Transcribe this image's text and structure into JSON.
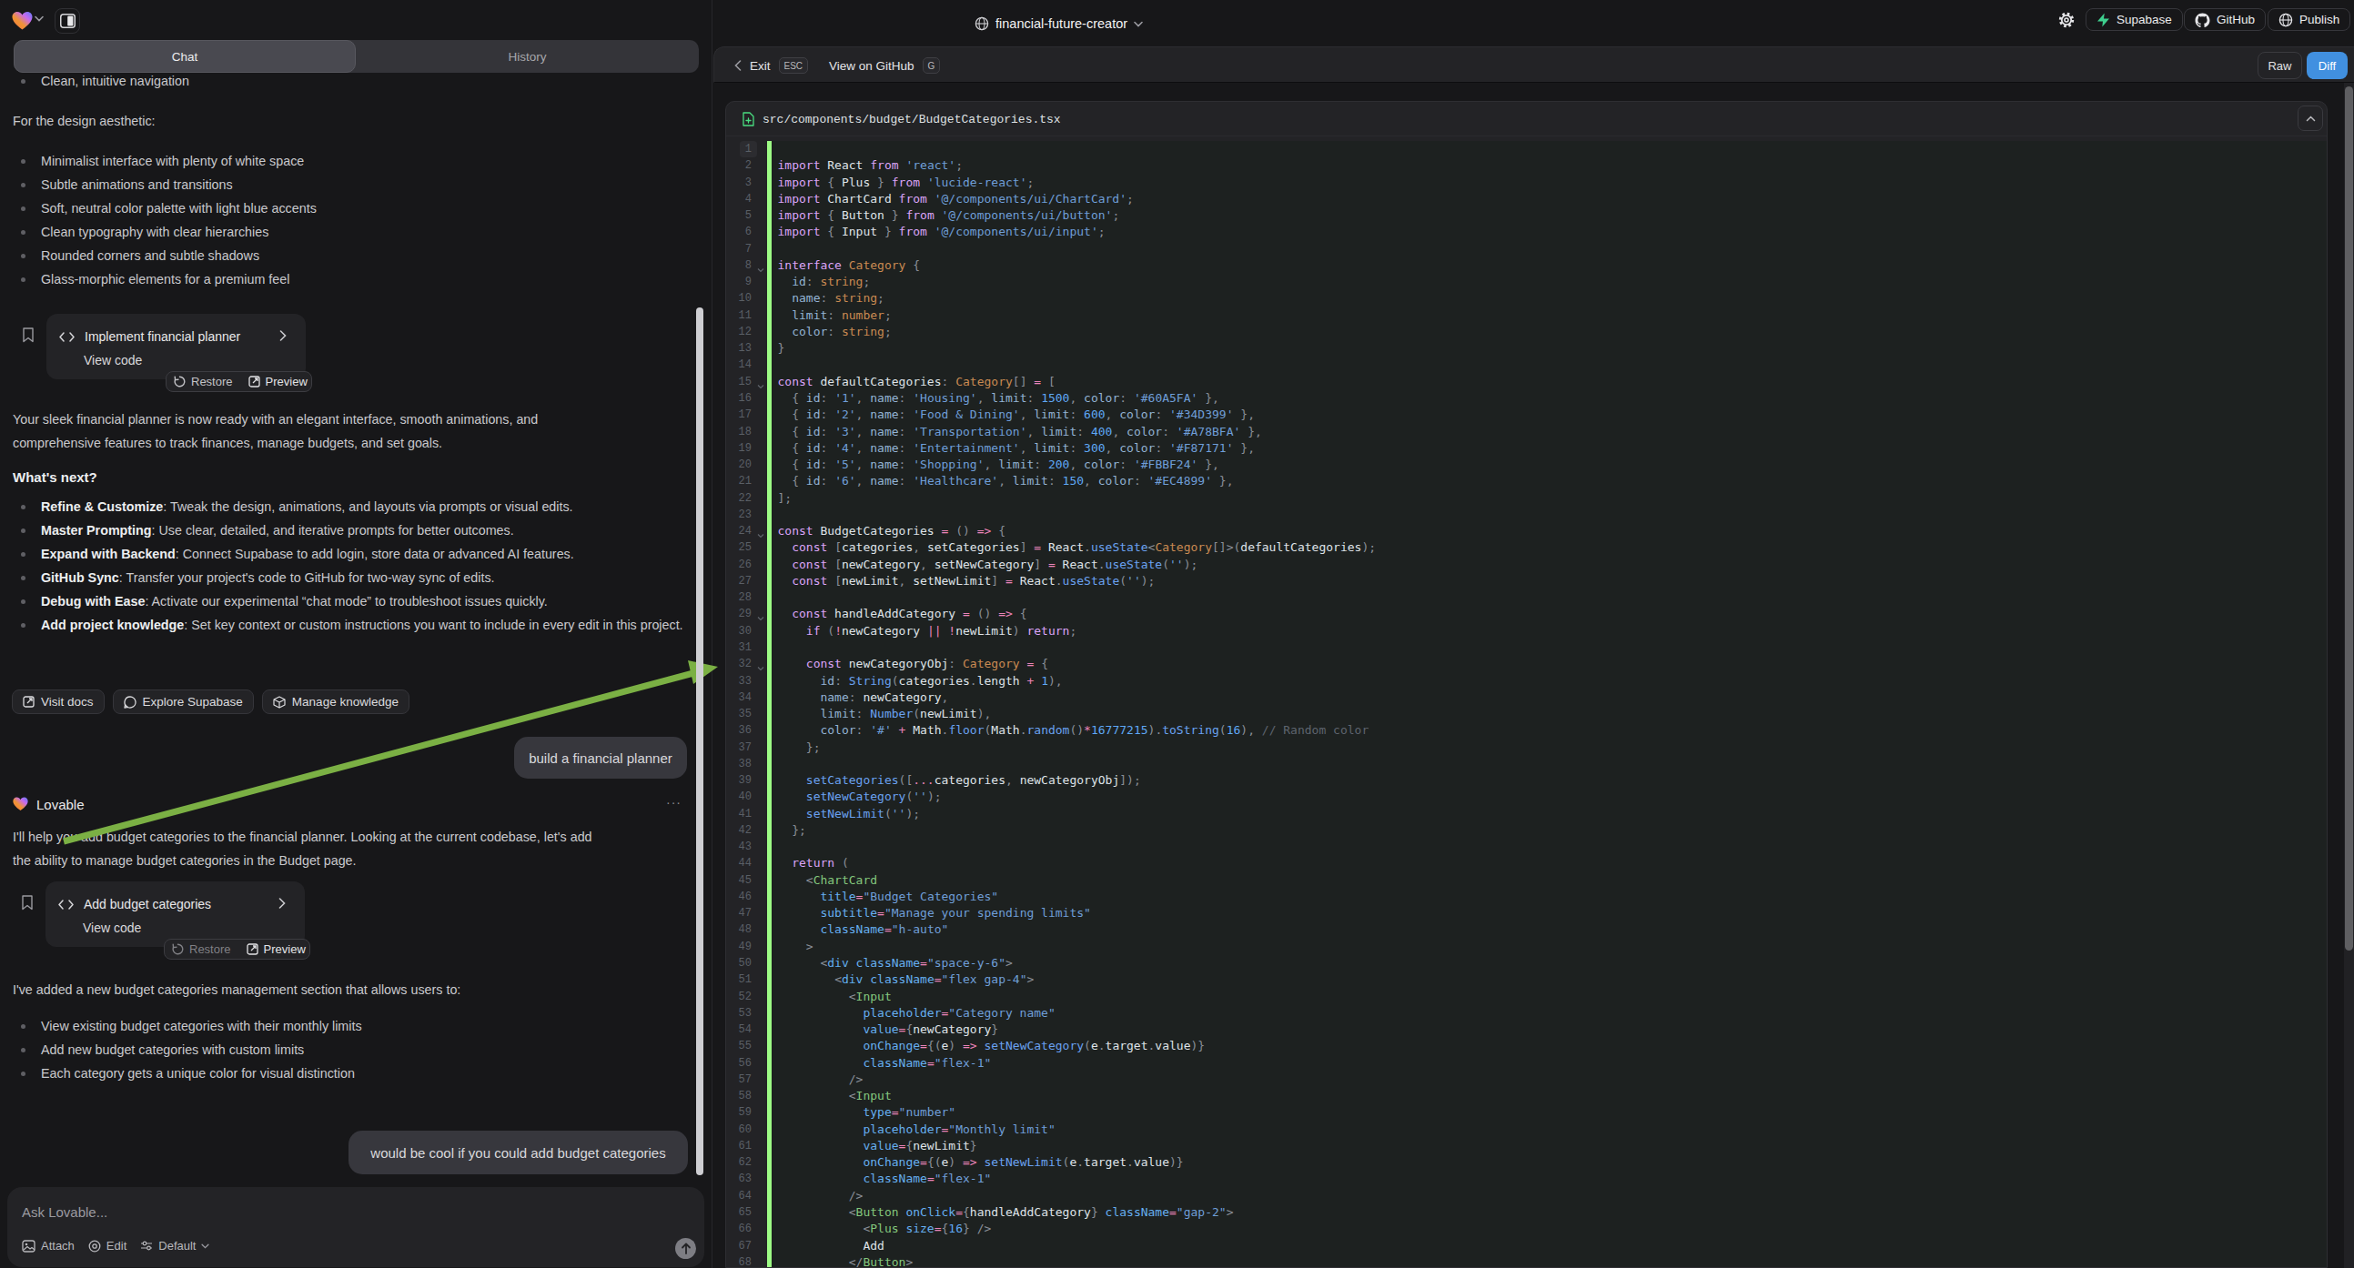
{
  "topbar": {
    "project_name": "financial-future-creator",
    "supabase_label": "Supabase",
    "github_label": "GitHub",
    "publish_label": "Publish"
  },
  "tabs": {
    "chat": "Chat",
    "history": "History"
  },
  "chat": {
    "intro_bullet": "Clean, intuitive navigation",
    "design_heading": "For the design aesthetic:",
    "design_bullets": [
      "Minimalist interface with plenty of white space",
      "Subtle animations and transitions",
      "Soft, neutral color palette with light blue accents",
      "Clean typography with clear hierarchies",
      "Rounded corners and subtle shadows",
      "Glass-morphic elements for a premium feel"
    ],
    "card1": {
      "title": "Implement financial planner",
      "view_code": "View code",
      "restore": "Restore",
      "preview": "Preview"
    },
    "ready_paragraph": "Your sleek financial planner is now ready with an elegant interface, smooth animations, and comprehensive features to track finances, manage budgets, and set goals.",
    "whats_next": "What's next?",
    "next_items": [
      {
        "bold": "Refine & Customize",
        "rest": ": Tweak the design, animations, and layouts via prompts or visual edits."
      },
      {
        "bold": "Master Prompting",
        "rest": ": Use clear, detailed, and iterative prompts for better outcomes."
      },
      {
        "bold": "Expand with Backend",
        "rest": ": Connect Supabase to add login, store data or advanced AI features."
      },
      {
        "bold": "GitHub Sync",
        "rest": ": Transfer your project's code to GitHub for two-way sync of edits."
      },
      {
        "bold": "Debug with Ease",
        "rest": ": Activate our experimental “chat mode” to troubleshoot issues quickly."
      },
      {
        "bold": "Add project knowledge",
        "rest": ": Set key context or custom instructions you want to include in every edit in this project."
      }
    ],
    "action_buttons": [
      "Visit docs",
      "Explore Supabase",
      "Manage knowledge"
    ],
    "user_message_1": "build a financial planner",
    "assistant_name": "Lovable",
    "help_paragraph": "I'll help you add budget categories to the financial planner. Looking at the current codebase, let's add the ability to manage budget categories in the Budget page.",
    "card2": {
      "title": "Add budget categories",
      "view_code": "View code",
      "restore": "Restore",
      "preview": "Preview"
    },
    "added_paragraph": "I've added a new budget categories management section that allows users to:",
    "added_bullets": [
      "View existing budget categories with their monthly limits",
      "Add new budget categories with custom limits",
      "Each category gets a unique color for visual distinction"
    ],
    "user_message_2": "would be cool if you could add budget categories",
    "input_placeholder": "Ask Lovable...",
    "input_buttons": {
      "attach": "Attach",
      "edit": "Edit",
      "mode": "Default"
    }
  },
  "codepanel": {
    "exit_label": "Exit",
    "exit_kbd": "ESC",
    "github_link": "View on GitHub",
    "github_kbd": "G",
    "raw_label": "Raw",
    "diff_label": "Diff",
    "filename": "src/components/budget/BudgetCategories.tsx",
    "fold_lines": [
      8,
      15,
      24,
      29,
      32
    ],
    "code_lines": [
      "",
      "import React from 'react';",
      "import { Plus } from 'lucide-react';",
      "import ChartCard from '@/components/ui/ChartCard';",
      "import { Button } from '@/components/ui/button';",
      "import { Input } from '@/components/ui/input';",
      "",
      "interface Category {",
      "  id: string;",
      "  name: string;",
      "  limit: number;",
      "  color: string;",
      "}",
      "",
      "const defaultCategories: Category[] = [",
      "  { id: '1', name: 'Housing', limit: 1500, color: '#60A5FA' },",
      "  { id: '2', name: 'Food & Dining', limit: 600, color: '#34D399' },",
      "  { id: '3', name: 'Transportation', limit: 400, color: '#A78BFA' },",
      "  { id: '4', name: 'Entertainment', limit: 300, color: '#F87171' },",
      "  { id: '5', name: 'Shopping', limit: 200, color: '#FBBF24' },",
      "  { id: '6', name: 'Healthcare', limit: 150, color: '#EC4899' },",
      "];",
      "",
      "const BudgetCategories = () => {",
      "  const [categories, setCategories] = React.useState<Category[]>(defaultCategories);",
      "  const [newCategory, setNewCategory] = React.useState('');",
      "  const [newLimit, setNewLimit] = React.useState('');",
      "",
      "  const handleAddCategory = () => {",
      "    if (!newCategory || !newLimit) return;",
      "",
      "    const newCategoryObj: Category = {",
      "      id: String(categories.length + 1),",
      "      name: newCategory,",
      "      limit: Number(newLimit),",
      "      color: '#' + Math.floor(Math.random()*16777215).toString(16), // Random color",
      "    };",
      "",
      "    setCategories([...categories, newCategoryObj]);",
      "    setNewCategory('');",
      "    setNewLimit('');",
      "  };",
      "",
      "  return (",
      "    <ChartCard",
      "      title=\"Budget Categories\"",
      "      subtitle=\"Manage your spending limits\"",
      "      className=\"h-auto\"",
      "    >",
      "      <div className=\"space-y-6\">",
      "        <div className=\"flex gap-4\">",
      "          <Input",
      "            placeholder=\"Category name\"",
      "            value={newCategory}",
      "            onChange={(e) => setNewCategory(e.target.value)}",
      "            className=\"flex-1\"",
      "          />",
      "          <Input",
      "            type=\"number\"",
      "            placeholder=\"Monthly limit\"",
      "            value={newLimit}",
      "            onChange={(e) => setNewLimit(e.target.value)}",
      "            className=\"flex-1\"",
      "          />",
      "          <Button onClick={handleAddCategory} className=\"gap-2\">",
      "            <Plus size={16} />",
      "            Add",
      "          </Button>"
    ]
  },
  "colors": {
    "accent_blue": "#4190e0",
    "diff_green": "#9dfb85",
    "arrow_green": "#7bb044",
    "supabase_green": "#3ecf8e"
  }
}
